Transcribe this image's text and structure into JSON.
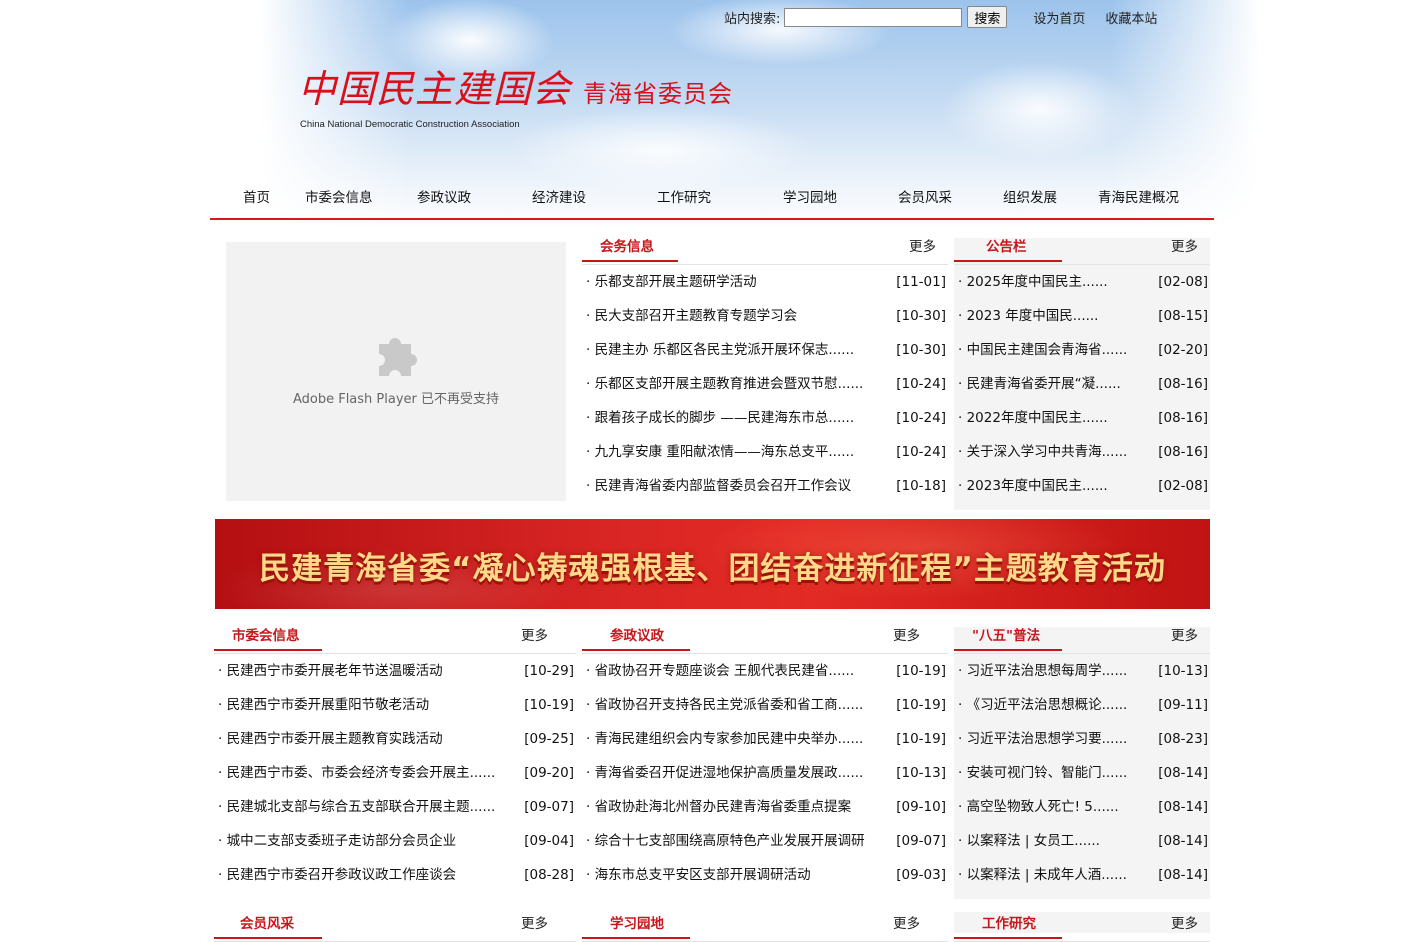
{
  "topbar": {
    "search_label": "站内搜索:",
    "search_value": "",
    "search_button": "搜索",
    "set_home": "设为首页",
    "bookmark": "收藏本站"
  },
  "logo": {
    "cn": "中国民主建国会",
    "sub": "青海省委员会",
    "en": "China National Democratic Construction Association"
  },
  "nav": [
    "首页",
    "市委会信息",
    "参政议政",
    "经济建设",
    "工作研究",
    "学习园地",
    "会员风采",
    "组织发展",
    "青海民建概况"
  ],
  "flash": {
    "message": "Adobe Flash Player 已不再受支持"
  },
  "banner": {
    "text": "民建青海省委“凝心铸魂强根基、团结奋进新征程”主题教育活动"
  },
  "panels": {
    "huiwu": {
      "title": "会务信息",
      "more": "更多",
      "items": [
        {
          "t": "· 乐都支部开展主题研学活动",
          "d": "[11-01]"
        },
        {
          "t": "· 民大支部召开主题教育专题学习会",
          "d": "[10-30]"
        },
        {
          "t": "· 民建主办 乐都区各民主党派开展环保志......",
          "d": "[10-30]"
        },
        {
          "t": "· 乐都区支部开展主题教育推进会暨双节慰......",
          "d": "[10-24]"
        },
        {
          "t": "· 跟着孩子成长的脚步 ——民建海东市总......",
          "d": "[10-24]"
        },
        {
          "t": "· 九九享安康 重阳献浓情——海东总支平......",
          "d": "[10-24]"
        },
        {
          "t": "· 民建青海省委内部监督委员会召开工作会议",
          "d": "[10-18]"
        }
      ]
    },
    "gonggao": {
      "title": "公告栏",
      "more": "更多",
      "items": [
        {
          "t": "· 2025年度中国民主......",
          "d": "[02-08]"
        },
        {
          "t": "· 2023 年度中国民......",
          "d": "[08-15]"
        },
        {
          "t": "· 中国民主建国会青海省......",
          "d": "[02-20]"
        },
        {
          "t": "· 民建青海省委开展“凝......",
          "d": "[08-16]"
        },
        {
          "t": "· 2022年度中国民主......",
          "d": "[08-16]"
        },
        {
          "t": "· 关于深入学习中共青海......",
          "d": "[08-16]"
        },
        {
          "t": "· 2023年度中国民主......",
          "d": "[02-08]"
        }
      ]
    },
    "shiwei": {
      "title": "市委会信息",
      "more": "更多",
      "items": [
        {
          "t": "· 民建西宁市委开展老年节送温暖活动",
          "d": "[10-29]"
        },
        {
          "t": "· 民建西宁市委开展重阳节敬老活动",
          "d": "[10-19]"
        },
        {
          "t": "· 民建西宁市委开展主题教育实践活动",
          "d": "[09-25]"
        },
        {
          "t": "· 民建西宁市委、市委会经济专委会开展主......",
          "d": "[09-20]"
        },
        {
          "t": "· 民建城北支部与综合五支部联合开展主题......",
          "d": "[09-07]"
        },
        {
          "t": "· 城中二支部支委班子走访部分会员企业",
          "d": "[09-04]"
        },
        {
          "t": "· 民建西宁市委召开参政议政工作座谈会",
          "d": "[08-28]"
        }
      ]
    },
    "canzheng": {
      "title": "参政议政",
      "more": "更多",
      "items": [
        {
          "t": "· 省政协召开专题座谈会 王舰代表民建省......",
          "d": "[10-19]"
        },
        {
          "t": "· 省政协召开支持各民主党派省委和省工商......",
          "d": "[10-19]"
        },
        {
          "t": "· 青海民建组织会内专家参加民建中央举办......",
          "d": "[10-19]"
        },
        {
          "t": "· 青海省委召开促进湿地保护高质量发展政......",
          "d": "[10-13]"
        },
        {
          "t": "· 省政协赴海北州督办民建青海省委重点提案",
          "d": "[09-10]"
        },
        {
          "t": "· 综合十七支部围绕高原特色产业发展开展调研",
          "d": "[09-07]"
        },
        {
          "t": "· 海东市总支平安区支部开展调研活动",
          "d": "[09-03]"
        }
      ]
    },
    "bawu": {
      "title": "\"八五\"普法",
      "more": "更多",
      "items": [
        {
          "t": "· 习近平法治思想每周学......",
          "d": "[10-13]"
        },
        {
          "t": "· 《习近平法治思想概论......",
          "d": "[09-11]"
        },
        {
          "t": "· 习近平法治思想学习要......",
          "d": "[08-23]"
        },
        {
          "t": "· 安装可视门铃、智能门......",
          "d": "[08-14]"
        },
        {
          "t": "· 高空坠物致人死亡! 5......",
          "d": "[08-14]"
        },
        {
          "t": "· 以案释法 | 女员工......",
          "d": "[08-14]"
        },
        {
          "t": "· 以案释法 | 未成年人酒......",
          "d": "[08-14]"
        }
      ]
    },
    "huiyuan": {
      "title": "会员风采",
      "more": "更多"
    },
    "xuexi": {
      "title": "学习园地",
      "more": "更多"
    },
    "gongzuo": {
      "title": "工作研究",
      "more": "更多"
    }
  }
}
